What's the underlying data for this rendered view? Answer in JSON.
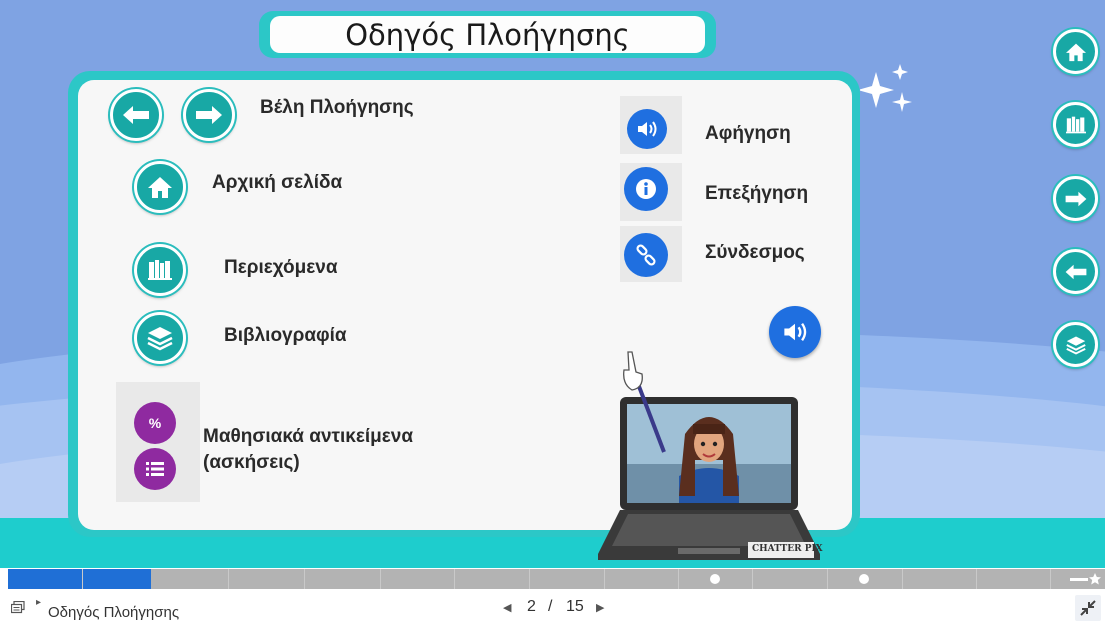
{
  "slide": {
    "title": "Οδηγός Πλοήγησης",
    "items": {
      "arrows_label": "Βέλη Πλοήγησης",
      "home_label": "Αρχική σελίδα",
      "contents_label": "Περιεχόμενα",
      "bibliography_label": "Βιβλιογραφία",
      "learning_objects_label_line1": "Μαθησιακά αντικείμενα",
      "learning_objects_label_line2": "(ασκήσεις)",
      "narration_label": "Αφήγηση",
      "explanation_label": "Επεξήγηση",
      "link_label": "Σύνδεσμος"
    },
    "sidebar_icons": [
      "home-icon",
      "books-icon",
      "arrow-right-icon",
      "arrow-left-icon",
      "stack-icon"
    ],
    "laptop_brand": "CHATTER PIX"
  },
  "player": {
    "doc_title": "Οδηγός Πλοήγησης",
    "page_current": "2",
    "page_sep": "/",
    "page_total": "15",
    "progress_fraction": 0.13
  },
  "colors": {
    "sky": "#7fa3e3",
    "teal": "#2cc7c7",
    "button_teal": "#18a8a5",
    "blue_icon": "#1f6fe0",
    "purple_icon": "#8f2aa0",
    "progress": "#1f6fd6"
  }
}
